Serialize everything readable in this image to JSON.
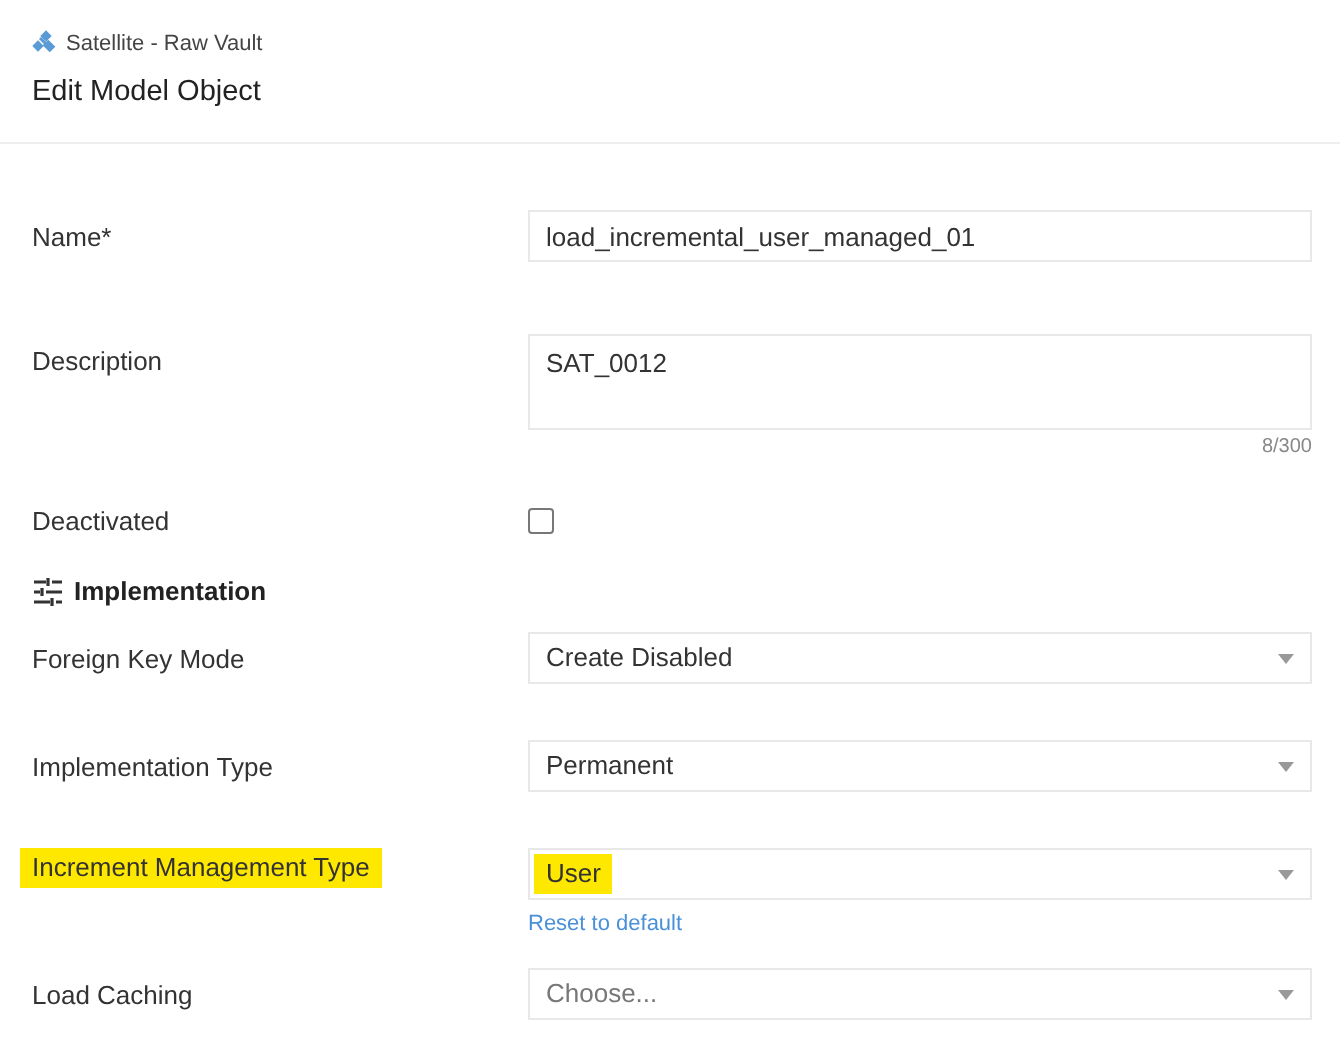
{
  "header": {
    "breadcrumb": "Satellite - Raw Vault",
    "title": "Edit Model Object"
  },
  "fields": [
    {
      "kind": "text",
      "label": "Name*",
      "value": "load_incremental_user_managed_01"
    },
    {
      "kind": "textarea",
      "label": "Description",
      "value": "SAT_0012",
      "counter": "8/300"
    },
    {
      "kind": "checkbox",
      "label": "Deactivated",
      "checked": false
    },
    {
      "kind": "section",
      "label": "Implementation"
    },
    {
      "kind": "select",
      "label": "Foreign Key Mode",
      "value": "Create Disabled",
      "highlighted": false
    },
    {
      "kind": "select",
      "label": "Implementation Type",
      "value": "Permanent",
      "highlighted": false
    },
    {
      "kind": "select",
      "label": "Increment Management Type",
      "value": "User",
      "highlighted": true,
      "reset_link": "Reset to default"
    },
    {
      "kind": "select",
      "label": "Load Caching",
      "placeholder": "Choose...",
      "highlighted": false
    }
  ]
}
